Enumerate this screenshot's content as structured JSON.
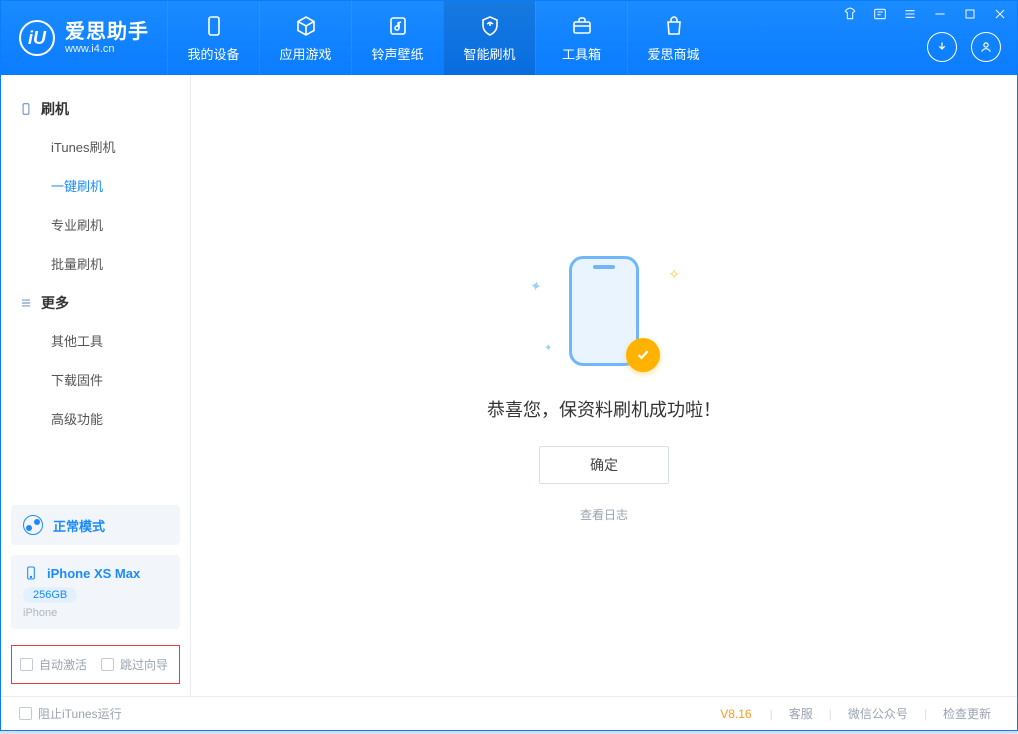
{
  "brand": {
    "title": "爱思助手",
    "subtitle": "www.i4.cn",
    "logo_letter": "iU"
  },
  "nav": {
    "tabs": [
      {
        "label": "我的设备",
        "icon": "device"
      },
      {
        "label": "应用游戏",
        "icon": "cube"
      },
      {
        "label": "铃声壁纸",
        "icon": "music"
      },
      {
        "label": "智能刷机",
        "icon": "shield",
        "active": true
      },
      {
        "label": "工具箱",
        "icon": "toolbox"
      },
      {
        "label": "爱思商城",
        "icon": "bag"
      }
    ]
  },
  "sidebar": {
    "groups": [
      {
        "title": "刷机",
        "icon": "phone",
        "items": [
          "iTunes刷机",
          "一键刷机",
          "专业刷机",
          "批量刷机"
        ],
        "active_index": 1
      },
      {
        "title": "更多",
        "icon": "menu",
        "items": [
          "其他工具",
          "下载固件",
          "高级功能"
        ]
      }
    ],
    "mode": {
      "label": "正常模式"
    },
    "device": {
      "name": "iPhone XS Max",
      "storage": "256GB",
      "type": "iPhone"
    },
    "options": {
      "auto_activate": "自动激活",
      "skip_wizard": "跳过向导"
    }
  },
  "main": {
    "success_text": "恭喜您，保资料刷机成功啦！",
    "ok_button": "确定",
    "log_link": "查看日志"
  },
  "footer": {
    "block_itunes": "阻止iTunes运行",
    "version": "V8.16",
    "links": [
      "客服",
      "微信公众号",
      "检查更新"
    ]
  }
}
